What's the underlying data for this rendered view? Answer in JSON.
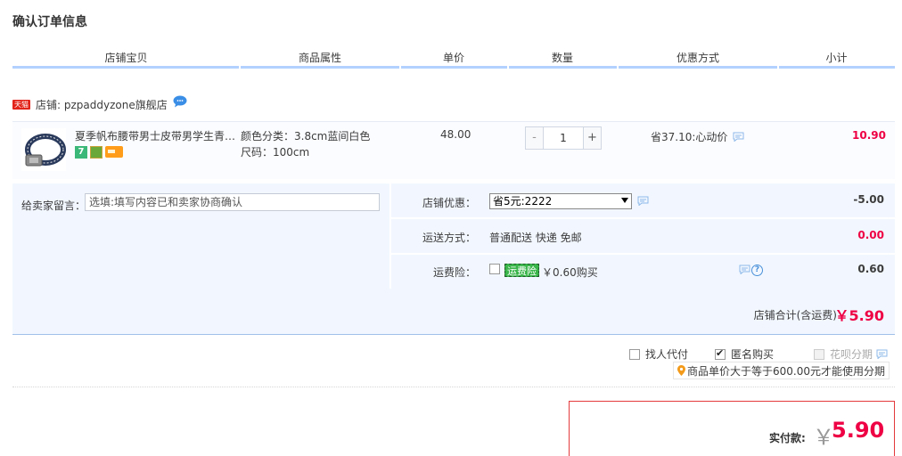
{
  "page_title": "确认订单信息",
  "columns": [
    "店铺宝贝",
    "商品属性",
    "单价",
    "数量",
    "优惠方式",
    "小计"
  ],
  "shop": {
    "badge": "天猫",
    "label": "店铺: pzpaddyzone旗舰店"
  },
  "item": {
    "title": "夏季帆布腰带男士皮带男学生青…",
    "badges": {
      "seven": "7"
    },
    "attr_color": "颜色分类：3.8cm蓝间白色",
    "attr_size": "尺码：100cm",
    "price": "48.00",
    "quantity": "1",
    "minus": "-",
    "plus": "+",
    "promo": "省37.10:心动价",
    "subtotal": "10.90"
  },
  "message": {
    "label": "给卖家留言：",
    "placeholder": "选填:填写内容已和卖家协商确认"
  },
  "shop_discount": {
    "label": "店铺优惠：",
    "selected": "省5元:2222",
    "amount": "-5.00"
  },
  "shipping": {
    "label": "运送方式：",
    "value": "普通配送 快递 免邮",
    "amount": "0.00"
  },
  "insurance": {
    "label": "运费险：",
    "badge": "运费险",
    "text": "￥0.60购买",
    "amount": "0.60"
  },
  "shop_total": {
    "label": "店铺合计(含运费)",
    "value": "￥5.90"
  },
  "options": {
    "proxy_pay": "找人代付",
    "anonymous": "匿名购买",
    "huabei": "花呗分期"
  },
  "tip": "商品单价大于等于600.00元才能使用分期",
  "payment": {
    "label": "实付款:",
    "currency": "￥",
    "value": "5.90"
  },
  "colors": {
    "accent_red": "#ee0044",
    "header_line": "#b2d1ff",
    "panel_bg": "#f2f7ff",
    "insurance_green": "#3ab54a"
  },
  "icons": [
    "tmall-badge",
    "chat-bubble-icon",
    "seven-day-return-icon",
    "safeguard-icon",
    "credit-card-icon",
    "message-icon",
    "question-icon",
    "location-pin-icon"
  ]
}
